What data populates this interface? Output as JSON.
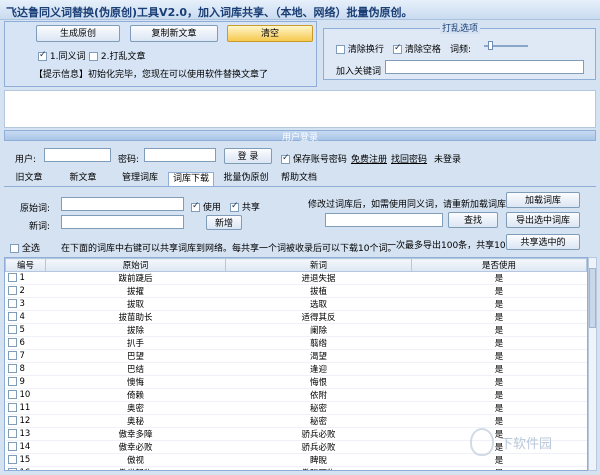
{
  "window": {
    "title": "飞达鲁同义词替换(伪原创)工具V2.0，加入词库共享、（本地、网络）批量伪原创。"
  },
  "toolbar": {
    "generate_label": "生成原创",
    "copy_label": "复制新文章",
    "clear_label": "清空",
    "synonym_opt": "1.同义词",
    "shuffle_opt": "2.打乱文章",
    "tip_text": "【提示信息】初始化完毕，您现在可以使用软件替换文章了"
  },
  "shuffle_panel": {
    "title": "打乱选项",
    "remove_newline": "清除换行",
    "remove_space": "清除空格",
    "word_freq": "词频:",
    "add_keyword": "加入关键词"
  },
  "login": {
    "title": "用户登录",
    "user_label": "用户:",
    "password_label": "密码:",
    "login_button": "登 录",
    "save_password": "保存账号密码",
    "free_register": "免费注册",
    "forgot_password": "找回密码",
    "status": "未登录"
  },
  "tabs": [
    "旧文章",
    "新文章",
    "管理词库",
    "词库下载",
    "批量伪原创",
    "帮助文档"
  ],
  "active_tab": "管理词库",
  "manage": {
    "orig_label": "原始词:",
    "new_label": "新词:",
    "use_label": "使用",
    "share_label": "共享",
    "add_button": "新增",
    "hint": "修改过词库后，如需使用同义词，请重新加载词库。",
    "load_button": "加载词库",
    "find_button": "查找",
    "export_button": "导出选中词库",
    "select_all": "全选",
    "share_hint": "在下面的词库中右键可以共享词库到网络。每共享一个词被收录后可以下载10个词。",
    "limit_hint": "一次最多导出100条，共享10条。",
    "share_button": "共享选中的"
  },
  "table": {
    "columns": [
      "编号",
      "原始词",
      "新词",
      "是否使用"
    ],
    "rows": [
      [
        "1",
        "跋前踕后",
        "进退失据",
        "是"
      ],
      [
        "2",
        "拔擢",
        "拔植",
        "是"
      ],
      [
        "3",
        "拔取",
        "选取",
        "是"
      ],
      [
        "4",
        "拔苗助长",
        "适得其反",
        "是"
      ],
      [
        "5",
        "拔除",
        "阑除",
        "是"
      ],
      [
        "6",
        "扒手",
        "翦绺",
        "是"
      ],
      [
        "7",
        "巴望",
        "渴望",
        "是"
      ],
      [
        "8",
        "巴结",
        "逢迎",
        "是"
      ],
      [
        "9",
        "懊悔",
        "悔恨",
        "是"
      ],
      [
        "10",
        "倚赖",
        "依附",
        "是"
      ],
      [
        "11",
        "奥密",
        "秘密",
        "是"
      ],
      [
        "12",
        "奥秘",
        "秘密",
        "是"
      ],
      [
        "13",
        "傲幸多障",
        "骄兵必败",
        "是"
      ],
      [
        "14",
        "傲幸必败",
        "骄兵必败",
        "是"
      ],
      [
        "15",
        "傲视",
        "睥睨",
        "是"
      ],
      [
        "16",
        "傲世轻物",
        "傲睨万物",
        "是"
      ]
    ]
  },
  "watermark": "下软件园",
  "colors": {
    "accent": "#1a3e75",
    "clear_button": "#f6c84f"
  }
}
